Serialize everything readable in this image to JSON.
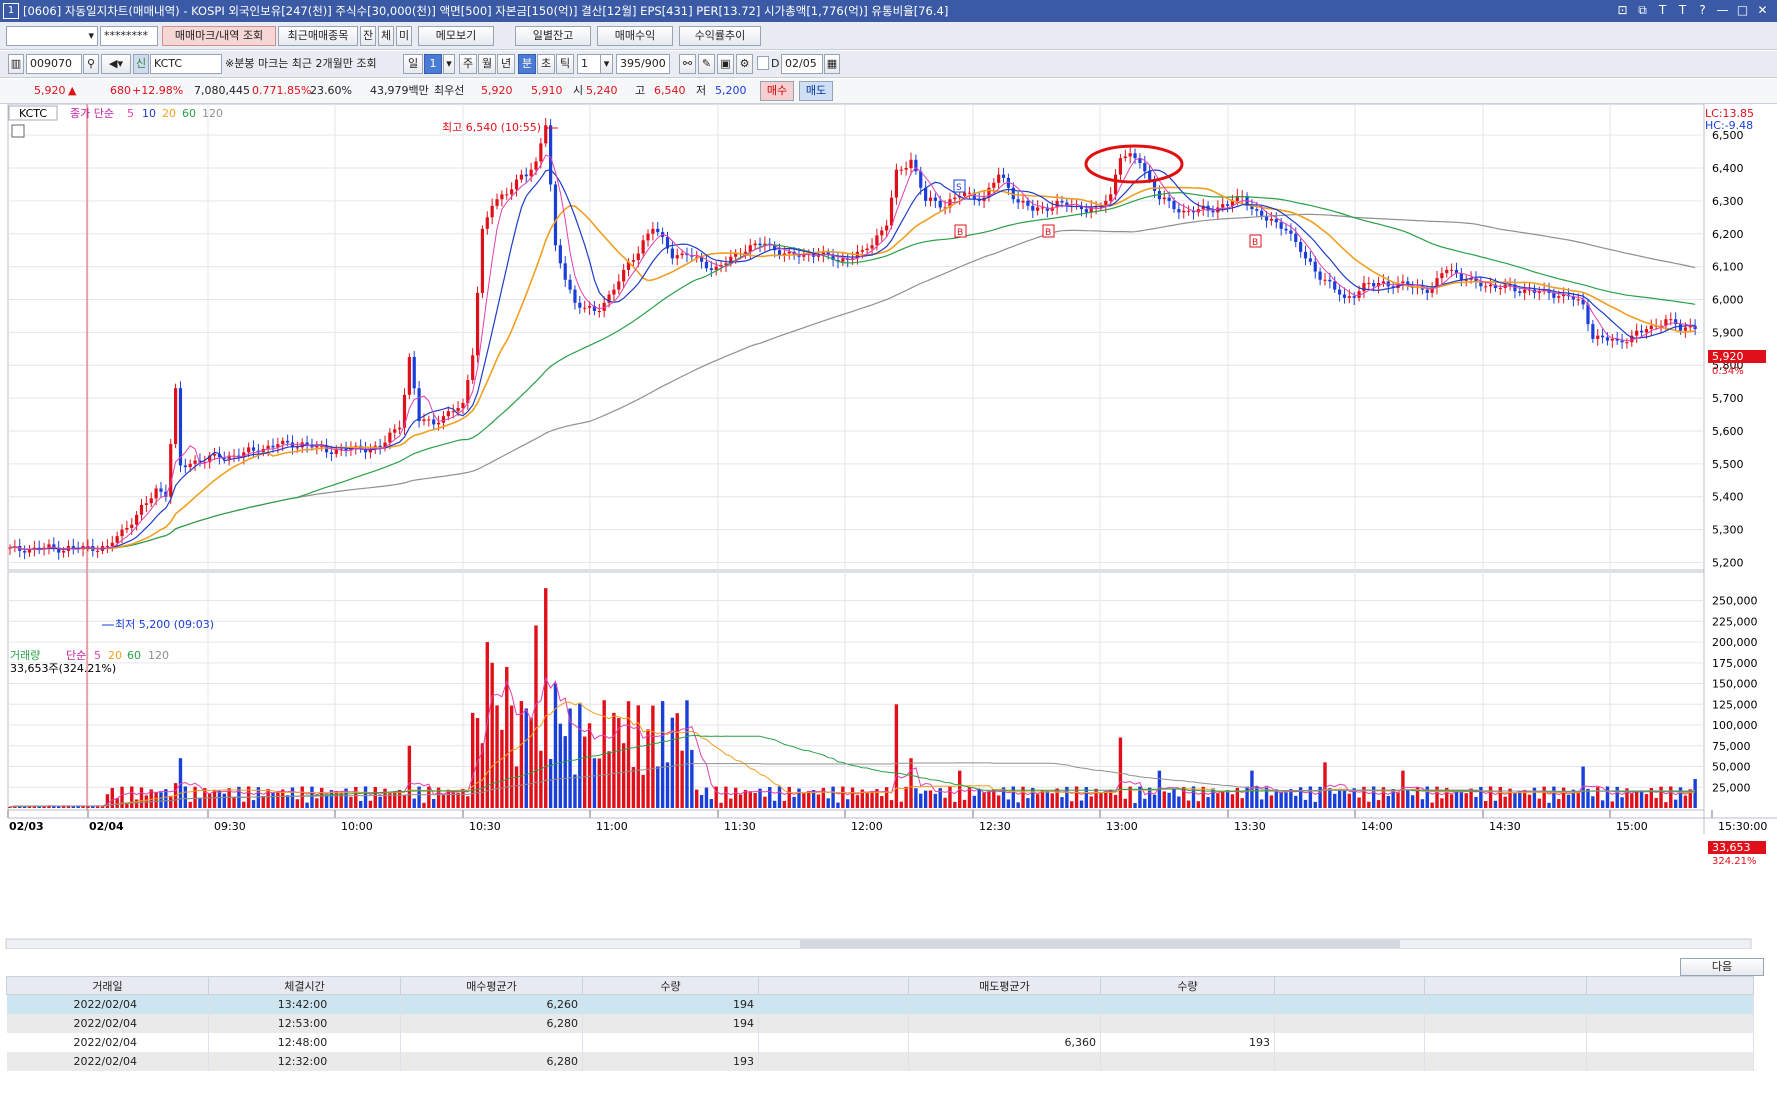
{
  "window": {
    "title": "[0606] 자동일지차트(매매내역) - KOSPI 외국인보유[247(천)] 주식수[30,000(천)] 액면[500] 자본금[150(억)] 결산[12월] EPS[431] PER[13.72] 시가총액[1,776(억)] 유통비율[76.4]",
    "icon_text": "1",
    "controls": [
      "⊡",
      "⧉",
      "T",
      "T",
      "?",
      "—",
      "□",
      "✕"
    ]
  },
  "toolbar1": {
    "password_mask": "********",
    "buttons": [
      "매매마크/내역 조회",
      "최근매매종목",
      "잔",
      "체",
      "미",
      "메모보기",
      "일별잔고",
      "매매수익",
      "수익률추이"
    ]
  },
  "toolbar2": {
    "code": "009070",
    "name": "KCTC",
    "badge": "신",
    "notice": "※분봉 마크는 최근 2개월만 조회",
    "period_buttons": [
      "일",
      "1",
      "주",
      "월",
      "년",
      "분",
      "초",
      "틱"
    ],
    "interval": "1",
    "count": "395/900",
    "date_label": "D",
    "date": "02/05"
  },
  "quote": {
    "price": "5,920",
    "arrow": "▲",
    "change": "680",
    "change_pct": "+12.98%",
    "volume": "7,080,445",
    "vol_pct": "0.771.85%",
    "turnover": "23.60%",
    "amount": "43,979백만",
    "priority_label": "최우선",
    "ask": "5,920",
    "bid": "5,910",
    "open_label": "시",
    "open": "5,240",
    "high_label": "고",
    "high": "6,540",
    "low_label": "저",
    "low": "5,200",
    "buy": "매수",
    "sell": "매도"
  },
  "price_panel": {
    "symbol": "KCTC",
    "legend_prefix": "종가 단순",
    "ma": [
      "5",
      "10",
      "20",
      "60",
      "120"
    ],
    "high_annotation": "최고 6,540 (10:55)",
    "low_annotation": "최저 5,200 (09:03)",
    "lc": "LC:13.85",
    "hc": "HC:-9.48",
    "current_price": "5,920",
    "current_pct": "0.34%"
  },
  "volume_panel": {
    "title": "거래량",
    "legend_prefix": "단순",
    "ma": [
      "5",
      "20",
      "60",
      "120"
    ],
    "summary": "33,653주(324.21%)",
    "current": "33,653",
    "current_pct": "324.21%"
  },
  "colors": {
    "ma5": "#e040b0",
    "ma10": "#1f3cc8",
    "ma20": "#f0a020",
    "ma60": "#2aa048",
    "ma120": "#909090",
    "up": "#e0101a",
    "down": "#1a3fd8"
  },
  "chart_data": {
    "type": "candlestick",
    "x_labels": [
      "02/03",
      "02/04",
      "09:30",
      "10:00",
      "10:30",
      "11:00",
      "11:30",
      "12:00",
      "12:30",
      "13:00",
      "13:30",
      "14:00",
      "14:30",
      "15:00",
      "15:30:00"
    ],
    "y_price_ticks": [
      6500,
      6400,
      6300,
      6200,
      6100,
      6000,
      5900,
      5800,
      5700,
      5600,
      5500,
      5400,
      5300,
      5200
    ],
    "y_volume_ticks": [
      250000,
      225000,
      200000,
      175000,
      150000,
      125000,
      100000,
      75000,
      50000,
      25000
    ],
    "price_path": [
      [
        0,
        5240
      ],
      [
        18,
        5245
      ],
      [
        20,
        5240
      ],
      [
        21,
        5260
      ],
      [
        25,
        5330
      ],
      [
        28,
        5380
      ],
      [
        30,
        5420
      ],
      [
        32,
        5410
      ],
      [
        34,
        5720
      ],
      [
        35,
        5490
      ],
      [
        38,
        5510
      ],
      [
        42,
        5520
      ],
      [
        48,
        5530
      ],
      [
        55,
        5560
      ],
      [
        60,
        5560
      ],
      [
        65,
        5540
      ],
      [
        70,
        5545
      ],
      [
        76,
        5550
      ],
      [
        80,
        5620
      ],
      [
        82,
        5820
      ],
      [
        84,
        5630
      ],
      [
        87,
        5630
      ],
      [
        90,
        5650
      ],
      [
        93,
        5680
      ],
      [
        95,
        5840
      ],
      [
        97,
        6200
      ],
      [
        99,
        6290
      ],
      [
        102,
        6330
      ],
      [
        106,
        6380
      ],
      [
        108,
        6420
      ],
      [
        110,
        6540
      ],
      [
        112,
        6150
      ],
      [
        116,
        5990
      ],
      [
        120,
        5960
      ],
      [
        124,
        6030
      ],
      [
        128,
        6130
      ],
      [
        132,
        6220
      ],
      [
        136,
        6140
      ],
      [
        140,
        6130
      ],
      [
        145,
        6090
      ],
      [
        150,
        6150
      ],
      [
        155,
        6170
      ],
      [
        160,
        6130
      ],
      [
        165,
        6140
      ],
      [
        170,
        6120
      ],
      [
        175,
        6140
      ],
      [
        180,
        6230
      ],
      [
        182,
        6380
      ],
      [
        185,
        6430
      ],
      [
        188,
        6300
      ],
      [
        192,
        6290
      ],
      [
        195,
        6320
      ],
      [
        200,
        6310
      ],
      [
        203,
        6380
      ],
      [
        207,
        6300
      ],
      [
        210,
        6270
      ],
      [
        215,
        6290
      ],
      [
        220,
        6280
      ],
      [
        223,
        6270
      ],
      [
        226,
        6320
      ],
      [
        228,
        6440
      ],
      [
        232,
        6420
      ],
      [
        236,
        6310
      ],
      [
        240,
        6270
      ],
      [
        245,
        6270
      ],
      [
        250,
        6290
      ],
      [
        253,
        6310
      ],
      [
        255,
        6280
      ],
      [
        258,
        6240
      ],
      [
        262,
        6220
      ],
      [
        266,
        6120
      ],
      [
        270,
        6060
      ],
      [
        274,
        6000
      ],
      [
        278,
        6040
      ],
      [
        282,
        6050
      ],
      [
        287,
        6040
      ],
      [
        292,
        6030
      ],
      [
        295,
        6100
      ],
      [
        300,
        6050
      ],
      [
        305,
        6040
      ],
      [
        310,
        6030
      ],
      [
        315,
        6020
      ],
      [
        320,
        6010
      ],
      [
        323,
        5980
      ],
      [
        325,
        5890
      ],
      [
        330,
        5870
      ],
      [
        335,
        5900
      ],
      [
        340,
        5940
      ],
      [
        343,
        5910
      ],
      [
        346,
        5920
      ]
    ],
    "volume_spikes": [
      [
        34,
        30000
      ],
      [
        35,
        60000
      ],
      [
        82,
        75000
      ],
      [
        98,
        200000
      ],
      [
        99,
        175000
      ],
      [
        102,
        170000
      ],
      [
        106,
        120000
      ],
      [
        108,
        220000
      ],
      [
        110,
        265000
      ],
      [
        112,
        150000
      ],
      [
        115,
        120000
      ],
      [
        120,
        60000
      ],
      [
        130,
        40000
      ],
      [
        135,
        55000
      ],
      [
        140,
        70000
      ],
      [
        182,
        125000
      ],
      [
        185,
        60000
      ],
      [
        195,
        45000
      ],
      [
        228,
        85000
      ],
      [
        236,
        45000
      ],
      [
        255,
        45000
      ],
      [
        270,
        55000
      ],
      [
        286,
        45000
      ],
      [
        323,
        50000
      ],
      [
        346,
        35000
      ]
    ]
  },
  "trades": {
    "headers": [
      "거래일",
      "체결시간",
      "매수평균가",
      "수량",
      "",
      "매도평균가",
      "수량",
      "",
      "",
      ""
    ],
    "rows": [
      [
        "2022/02/04",
        "13:42:00",
        "6,260",
        "194",
        "",
        "",
        "",
        "",
        "",
        ""
      ],
      [
        "2022/02/04",
        "12:53:00",
        "6,280",
        "194",
        "",
        "",
        "",
        "",
        "",
        ""
      ],
      [
        "2022/02/04",
        "12:48:00",
        "",
        "",
        "",
        "6,360",
        "193",
        "",
        "",
        ""
      ],
      [
        "2022/02/04",
        "12:32:00",
        "6,280",
        "193",
        "",
        "",
        "",
        "",
        "",
        ""
      ]
    ],
    "next_button": "다음"
  }
}
